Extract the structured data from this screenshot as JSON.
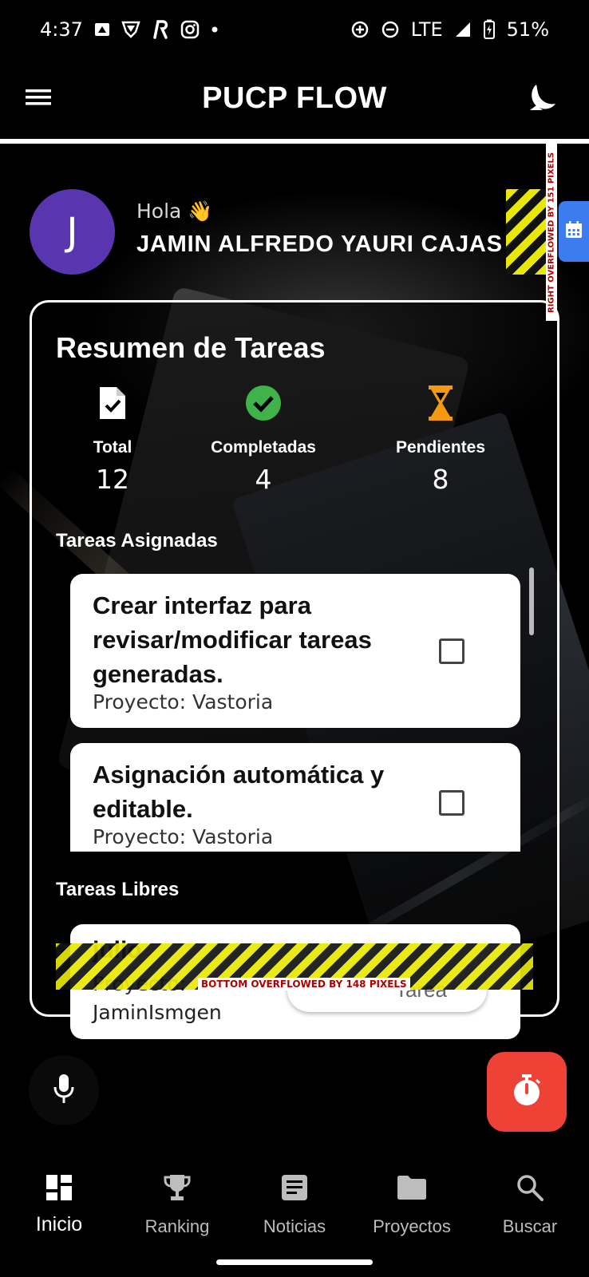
{
  "status_bar": {
    "time": "4:37",
    "network": "LTE",
    "battery": "51%",
    "left_icons": [
      "news-icon",
      "shield-app-icon",
      "r-app-icon",
      "instagram-icon",
      "dot-icon"
    ],
    "right_icons": [
      "data-saver-icon",
      "do-not-disturb-icon",
      "signal-icon",
      "battery-charging-icon"
    ]
  },
  "app_bar": {
    "title": "PUCP FLOW",
    "menu_icon": "hamburger-menu-icon",
    "theme_icon": "dark-mode-icon"
  },
  "greeting": {
    "avatar_letter": "J",
    "hello": "Hola 👋",
    "name": "JAMIN ALFREDO YAURI CAJAS",
    "overflow_right": "RIGHT OVERFLOWED BY 151 PIXELS"
  },
  "summary": {
    "title": "Resumen de Tareas",
    "stats": [
      {
        "label": "Total",
        "value": "12",
        "icon": "task-file-icon",
        "color": "#ffffff"
      },
      {
        "label": "Completadas",
        "value": "4",
        "icon": "check-circle-icon",
        "color": "#3fb24a"
      },
      {
        "label": "Pendientes",
        "value": "8",
        "icon": "hourglass-icon",
        "color": "#f59a10"
      }
    ]
  },
  "assigned": {
    "label": "Tareas Asignadas",
    "tasks": [
      {
        "title": " Crear interfaz para revisar/modificar tareas generadas.",
        "project": "Proyecto: Vastoria",
        "checked": false
      },
      {
        "title": " Asignación automática y editable.",
        "project": "Proyecto: Vastoria",
        "checked": false
      }
    ]
  },
  "free": {
    "label": "Tareas Libres",
    "task_title": "julio",
    "task_project": "Proyecto:",
    "task_owner": "JaminIsmgen",
    "ghost_button": "Tarea",
    "overflow_bottom": "BOTTOM OVERFLOWED BY 148 PIXELS"
  },
  "fab": {
    "mic_icon": "microphone-icon",
    "timer_icon": "timer-icon",
    "timer_color": "#ee4236"
  },
  "bottom_nav": [
    {
      "label": "Inicio",
      "icon": "dashboard-icon",
      "active": true
    },
    {
      "label": "Ranking",
      "icon": "trophy-icon",
      "active": false
    },
    {
      "label": "Noticias",
      "icon": "article-icon",
      "active": false
    },
    {
      "label": "Proyectos",
      "icon": "folder-icon",
      "active": false
    },
    {
      "label": "Buscar",
      "icon": "search-icon",
      "active": false
    }
  ],
  "colors": {
    "avatar": "#5a35b0",
    "calendar_tab": "#3d7bf0",
    "accent_red": "#ee4236"
  }
}
